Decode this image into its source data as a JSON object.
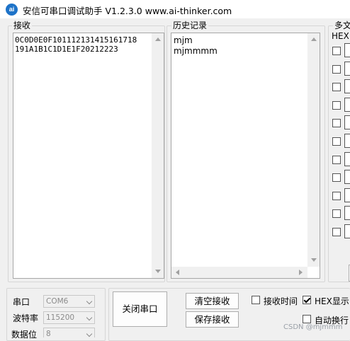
{
  "window": {
    "logo_text": "ai",
    "title": "安信可串口调试助手 V1.2.3.0     www.ai-thinker.com"
  },
  "receive": {
    "legend": "接收",
    "lines": [
      "0C0D0E0F101112131415161718",
      "191A1B1C1D1E1F20212223"
    ]
  },
  "history": {
    "legend": "历史记录",
    "items": [
      "mjm",
      "mjmmmm"
    ]
  },
  "multi": {
    "legend": "多文",
    "hex_header": "HEX",
    "row_count": 11
  },
  "port": {
    "port_label": "串口",
    "port_value": "COM6",
    "baud_label": "波特率",
    "baud_value": "115200",
    "databits_label": "数据位",
    "databits_value": "8"
  },
  "buttons": {
    "close_port": "关闭串口",
    "clear_receive": "清空接收",
    "save_receive": "保存接收"
  },
  "options": {
    "recv_time_label": "接收时间",
    "recv_time_checked": false,
    "hex_display_label": "HEX显示",
    "hex_display_checked": true,
    "auto_newline_label": "自动换行",
    "auto_newline_checked": false
  },
  "watermark": "CSDN @mjmmm"
}
